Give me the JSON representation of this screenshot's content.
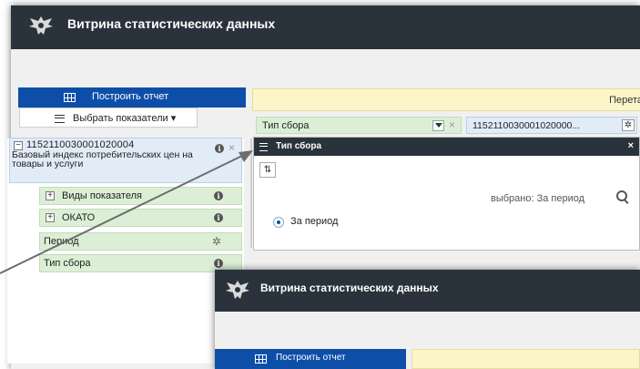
{
  "app": {
    "title": "Витрина статистических данных"
  },
  "toolbar": {
    "build_report": "Построить отчет",
    "select_indicators": "Выбрать показатели ▾"
  },
  "yellow_bar": {
    "text": "Перета"
  },
  "indicator": {
    "code": "1152110030001020004",
    "name": "Базовый индекс потребительских цен на товары и услуги",
    "collapse_symbol": "−",
    "info_symbol": "i",
    "remove_symbol": "×"
  },
  "dimensions": [
    {
      "label": "Виды показателя",
      "expand": "+"
    },
    {
      "label": "ОКАТО",
      "expand": "+"
    },
    {
      "label": "Период"
    },
    {
      "label": "Тип сбора"
    }
  ],
  "filter_header": {
    "label": "Тип сбора",
    "remove_symbol": "×",
    "code_cell": "1152110030001020000...",
    "gear": "✲"
  },
  "popup": {
    "title": "Тип сбора",
    "close": "×",
    "sliders": "⇅",
    "selected_label": "выбрано: За период",
    "option": "За период"
  },
  "second_window": {
    "title": "Витрина статистических данных",
    "build_report": "Построить отчет"
  },
  "colors": {
    "header_bg": "#2a333b",
    "primary_blue": "#0d4fa8",
    "dimension_green": "#dcefd6",
    "indicator_blue": "#e1ecf7",
    "yellow_bar": "#fbf5c8"
  },
  "icons": {
    "emblem": "eagle-emblem-icon",
    "grid": "table-grid-icon",
    "menu": "hamburger-icon",
    "gear": "gear-icon",
    "info": "info-icon",
    "search": "search-icon",
    "filter": "funnel-icon"
  }
}
